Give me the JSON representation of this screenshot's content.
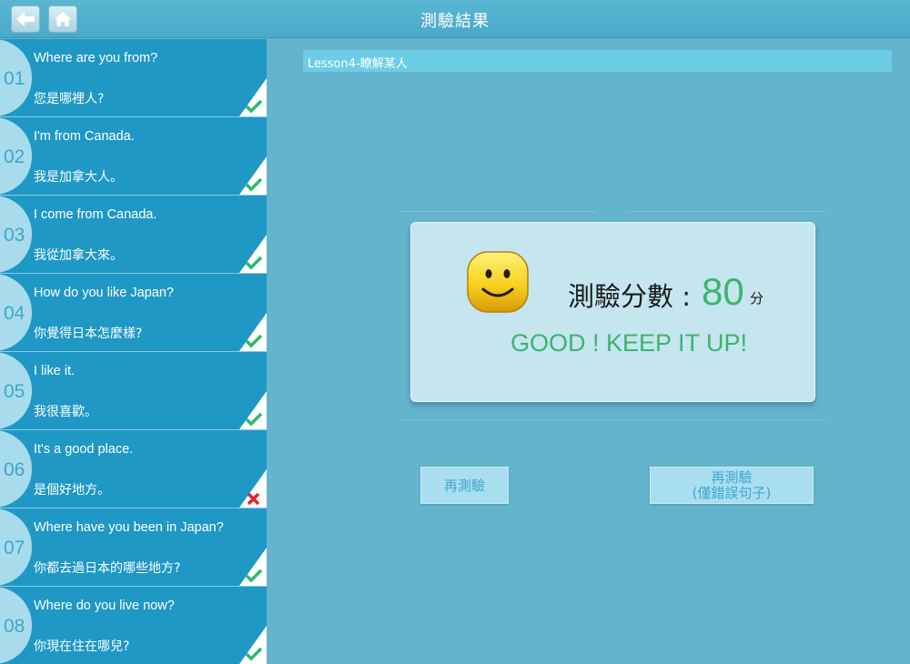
{
  "header": {
    "title": "測驗結果"
  },
  "lesson": {
    "label": "Lesson4-瞭解某人"
  },
  "questions": [
    {
      "num": "01",
      "en": "Where are you from?",
      "zh": "您是哪裡人?",
      "result": "correct"
    },
    {
      "num": "02",
      "en": "I'm from Canada.",
      "zh": "我是加拿大人。",
      "result": "correct"
    },
    {
      "num": "03",
      "en": "I come from Canada.",
      "zh": "我從加拿大來。",
      "result": "correct"
    },
    {
      "num": "04",
      "en": "How do you like Japan?",
      "zh": "你覺得日本怎麼樣?",
      "result": "correct"
    },
    {
      "num": "05",
      "en": "I like it.",
      "zh": "我很喜歡。",
      "result": "correct"
    },
    {
      "num": "06",
      "en": "It's a good place.",
      "zh": "是個好地方。",
      "result": "wrong"
    },
    {
      "num": "07",
      "en": "Where have you been in Japan?",
      "zh": "你都去過日本的哪些地方?",
      "result": "correct"
    },
    {
      "num": "08",
      "en": "Where do you live now?",
      "zh": "你現在住在哪兒?",
      "result": "correct"
    }
  ],
  "result": {
    "score_label": "測驗分數 :",
    "score": "80",
    "unit": "分",
    "message": "GOOD ! KEEP IT UP!"
  },
  "actions": {
    "retest_label": "再測驗",
    "retest_wrong_line1": "再測驗",
    "retest_wrong_line2": "(僅錯誤句子)"
  },
  "colors": {
    "background": "#64b4cd",
    "item_bg": "#1f98c6",
    "correct": "#2eb872",
    "wrong": "#e0242c",
    "score_green": "#3cb46e"
  }
}
